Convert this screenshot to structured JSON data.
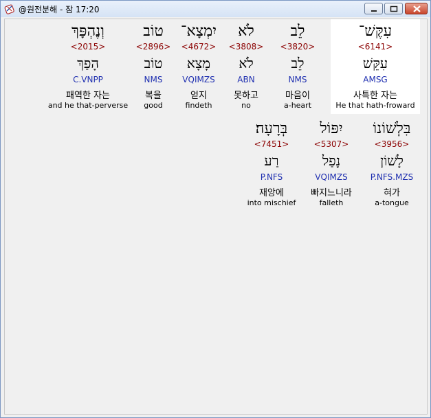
{
  "window": {
    "title": "@원전분해 - 잠 17:20"
  },
  "words": [
    {
      "heb": "עִקֶּשׁ־",
      "strong": "<6141>",
      "lemma": "עִקֵּשׁ",
      "parse": "AMSG",
      "korean": "사특한 자는",
      "english": "He that hath-froward"
    },
    {
      "heb": "לֵב",
      "strong": "<3820>",
      "lemma": "לֵב",
      "parse": "NMS",
      "korean": "마음이",
      "english": "a-heart"
    },
    {
      "heb": "לֹא",
      "strong": "<3808>",
      "lemma": "לֹא",
      "parse": "ABN",
      "korean": "못하고",
      "english": "no"
    },
    {
      "heb": "יִמְצָא־",
      "strong": "<4672>",
      "lemma": "מָצָא",
      "parse": "VQIMZS",
      "korean": "얻지",
      "english": "findeth"
    },
    {
      "heb": "טוֹב",
      "strong": "<2896>",
      "lemma": "טוֹב",
      "parse": "NMS",
      "korean": "복을",
      "english": "good"
    },
    {
      "heb": "וְנֶהְפָּךְ",
      "strong": "<2015>",
      "lemma": "הָפַךְ",
      "parse": "C.VNPP",
      "korean": "패역한 자는",
      "english": "and he that-perverse"
    },
    {
      "heb": "בִּלְשׁוֹנוֹ",
      "strong": "<3956>",
      "lemma": "לָשׁוֹן",
      "parse": "P.NFS.MZS",
      "korean": "혀가",
      "english": "a-tongue"
    },
    {
      "heb": "יִפּוֹל",
      "strong": "<5307>",
      "lemma": "נָפַל",
      "parse": "VQIMZS",
      "korean": "빠지느니라",
      "english": "falleth"
    },
    {
      "heb": "בְּרָעָה׃",
      "strong": "<7451>",
      "lemma": "רַע",
      "parse": "P.NFS",
      "korean": "재앙에",
      "english": "into mischief"
    }
  ]
}
